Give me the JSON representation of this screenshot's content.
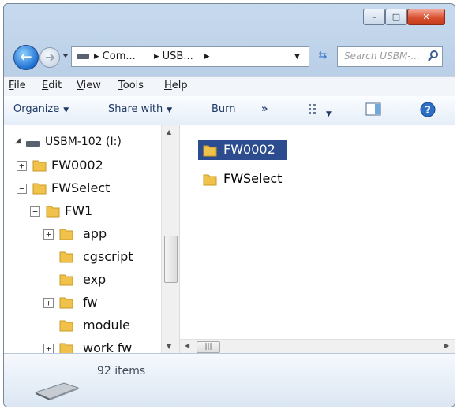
{
  "window_controls": {
    "minimize": "–",
    "maximize": "□",
    "close": "✕"
  },
  "address": {
    "crumbs": [
      "▸ Com...",
      "▸ USB...",
      "▸"
    ],
    "dropdown": "▼"
  },
  "search": {
    "placeholder": "Search USBM-..."
  },
  "menu": {
    "items": [
      {
        "u": "F",
        "rest": "ile"
      },
      {
        "u": "E",
        "rest": "dit"
      },
      {
        "u": "V",
        "rest": "iew"
      },
      {
        "u": "T",
        "rest": "ools"
      },
      {
        "u": "H",
        "rest": "elp"
      }
    ]
  },
  "toolbar": {
    "organize": "Organize",
    "share_with": "Share with",
    "burn": "Burn",
    "more": "»"
  },
  "tree": [
    {
      "label": "USBM-102 (I:)",
      "toggle": "◢",
      "kind": "drive"
    },
    {
      "label": "FW0002",
      "toggle": "+",
      "kind": "folder"
    },
    {
      "label": "FWSelect",
      "toggle": "−",
      "kind": "folder"
    },
    {
      "label": "FW1",
      "toggle": "−",
      "kind": "folder"
    },
    {
      "label": "app",
      "toggle": "+",
      "kind": "folder"
    },
    {
      "label": "cgscript",
      "toggle": "",
      "kind": "folder"
    },
    {
      "label": "exp",
      "toggle": "",
      "kind": "folder"
    },
    {
      "label": "fw",
      "toggle": "+",
      "kind": "folder"
    },
    {
      "label": "module",
      "toggle": "",
      "kind": "folder"
    },
    {
      "label": "work fw",
      "toggle": "+",
      "kind": "folder"
    }
  ],
  "files": [
    {
      "label": "FW0002",
      "selected": true
    },
    {
      "label": "FWSelect",
      "selected": false
    }
  ],
  "status": {
    "item_count": "92 items"
  },
  "colors": {
    "selection": "#2c4c8f",
    "folder": "#f0c24b",
    "link": "#1f3a64"
  },
  "icons": {
    "back": "arrow-left-icon",
    "forward": "arrow-right-icon",
    "help": "help-icon"
  }
}
